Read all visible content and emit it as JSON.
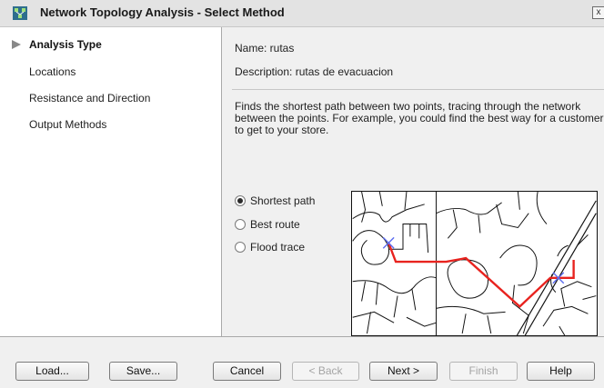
{
  "window": {
    "title": "Network Topology Analysis - Select Method",
    "close_label": "x"
  },
  "sidebar": {
    "items": [
      {
        "label": "Analysis Type",
        "active": true
      },
      {
        "label": "Locations",
        "active": false
      },
      {
        "label": "Resistance and Direction",
        "active": false
      },
      {
        "label": "Output Methods",
        "active": false
      }
    ]
  },
  "main": {
    "name_text": "Name: rutas",
    "description_text": "Description: rutas de evacuacion",
    "method_description": "Finds the shortest path between two points, tracing through the network between the points. For example, you could find the best way for a customer to get to your store.",
    "methods": [
      {
        "label": "Shortest path",
        "selected": true
      },
      {
        "label": "Best route",
        "selected": false
      },
      {
        "label": "Flood trace",
        "selected": false
      }
    ]
  },
  "footer": {
    "load_label": "Load...",
    "save_label": "Save...",
    "cancel_label": "Cancel",
    "back_label": "< Back",
    "next_label": "Next >",
    "finish_label": "Finish",
    "help_label": "Help"
  },
  "colors": {
    "route": "#e8231f",
    "marker": "#5b6cf0",
    "map_lines": "#111111"
  }
}
